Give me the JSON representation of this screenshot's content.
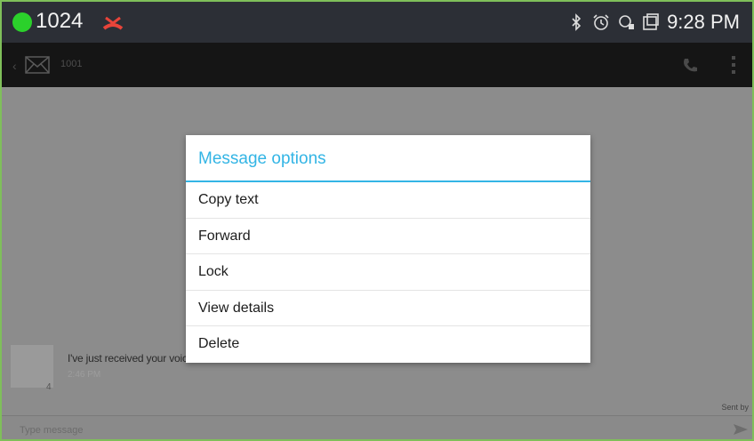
{
  "status_bar": {
    "extension": "1024",
    "time": "9:28 PM",
    "icons": [
      "bluetooth-icon",
      "alarm-icon",
      "headset-icon",
      "screen-icon"
    ],
    "accent": "#2bd12b"
  },
  "action_bar": {
    "title": "1001"
  },
  "conversation": {
    "message_text": "I've just received your voicemail.",
    "message_time": "2:46 PM",
    "message_sub": "4",
    "sent_meta": "Sent by",
    "compose_placeholder": "Type message"
  },
  "dialog": {
    "title": "Message options",
    "accent": "#33b5e5",
    "options": [
      "Copy text",
      "Forward",
      "Lock",
      "View details",
      "Delete"
    ]
  }
}
